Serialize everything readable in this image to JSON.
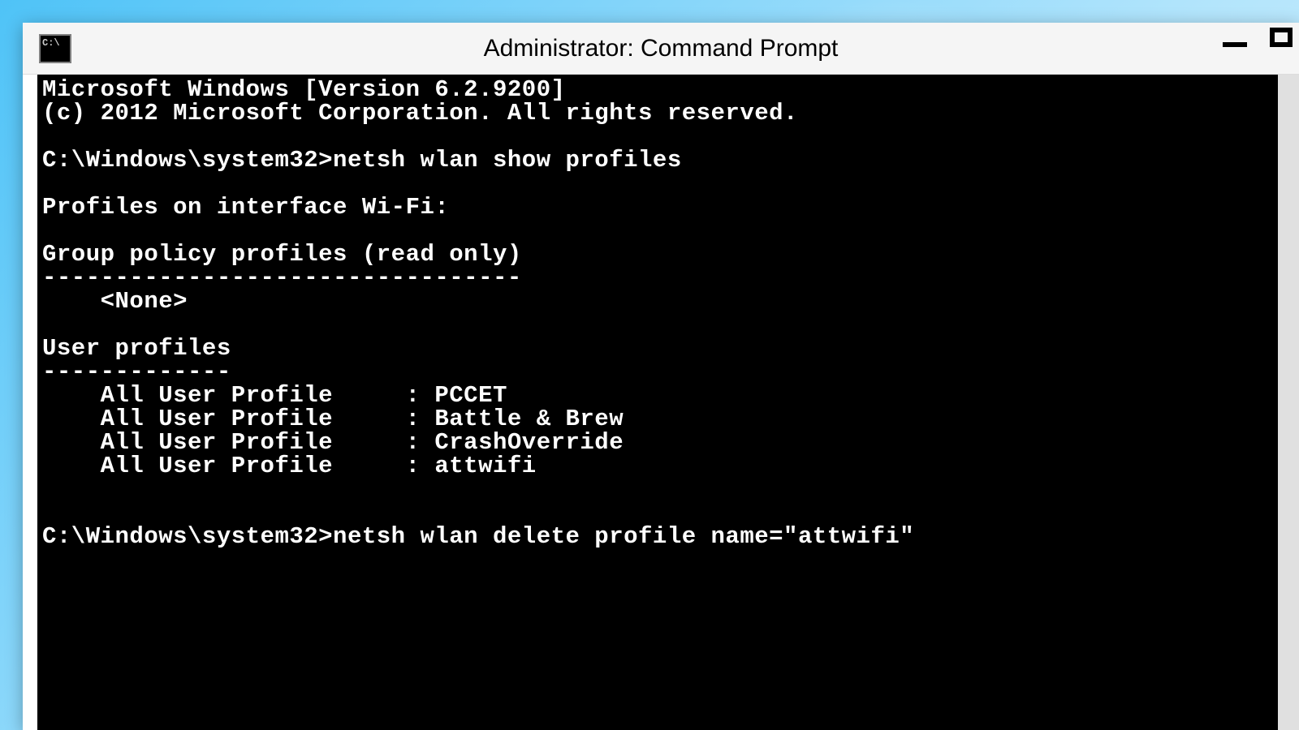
{
  "window": {
    "title": "Administrator: Command Prompt"
  },
  "terminal": {
    "line1": "Microsoft Windows [Version 6.2.9200]",
    "line2": "(c) 2012 Microsoft Corporation. All rights reserved.",
    "blank1": "",
    "prompt1": "C:\\Windows\\system32>netsh wlan show profiles",
    "blank2": "",
    "header1": "Profiles on interface Wi-Fi:",
    "blank3": "",
    "group_header": "Group policy profiles (read only)",
    "group_divider": "---------------------------------",
    "group_none": "    <None>",
    "blank4": "",
    "user_header": "User profiles",
    "user_divider": "-------------",
    "profile1": "    All User Profile     : PCCET",
    "profile2": "    All User Profile     : Battle & Brew",
    "profile3": "    All User Profile     : CrashOverride",
    "profile4": "    All User Profile     : attwifi",
    "blank5": "",
    "blank6": "",
    "prompt2": "C:\\Windows\\system32>netsh wlan delete profile name=\"attwifi\""
  }
}
